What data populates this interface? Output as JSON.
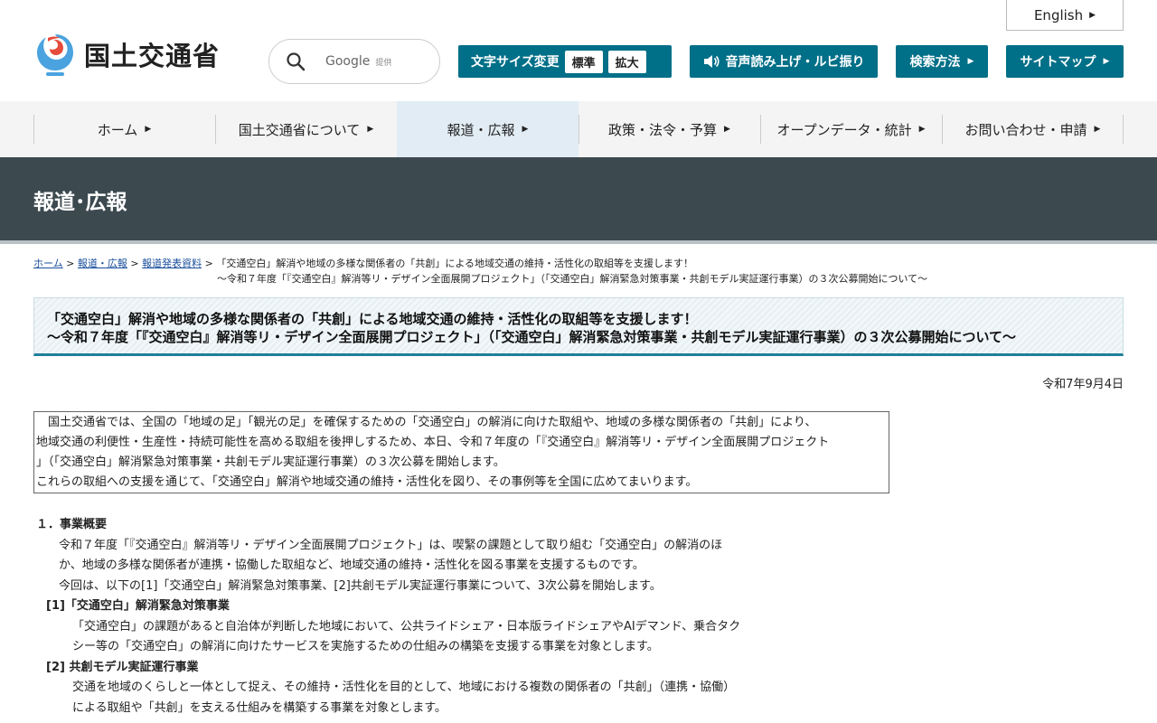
{
  "header": {
    "logo_text": "国土交通省",
    "english_label": "English",
    "search": {
      "google_label": "Google",
      "provided_label": "提供"
    },
    "font_size": {
      "label": "文字サイズ変更",
      "standard": "標準",
      "large": "拡大"
    },
    "voice_label": "音声読み上げ・ルビ振り",
    "howto_label": "検索方法",
    "sitemap_label": "サイトマップ"
  },
  "nav": {
    "items": [
      {
        "label": "ホーム"
      },
      {
        "label": "国土交通省について"
      },
      {
        "label": "報道・広報"
      },
      {
        "label": "政策・法令・予算"
      },
      {
        "label": "オープンデータ・統計"
      },
      {
        "label": "お問い合わせ・申請"
      }
    ]
  },
  "banner": {
    "title": "報道･広報"
  },
  "breadcrumb": {
    "home": "ホーム",
    "press": "報道・広報",
    "releases": "報道発表資料",
    "sep": ">",
    "current_line1": "「交通空白」解消や地域の多様な関係者の「共創」による地域交通の維持・活性化の取組等を支援します！",
    "current_line2": "～令和７年度「『交通空白』解消等リ・デザイン全面展開プロジェクト」（「交通空白」解消緊急対策事業・共創モデル実証運行事業）の３次公募開始について～"
  },
  "title": {
    "line1": "「交通空白」解消や地域の多様な関係者の「共創」による地域交通の維持・活性化の取組等を支援します！",
    "line2": "～令和７年度「『交通空白』解消等リ・デザイン全面展開プロジェクト」（「交通空白」解消緊急対策事業・共創モデル実証運行事業）の３次公募開始について～"
  },
  "date": "令和7年9月4日",
  "summary": {
    "line1": "国土交通省では、全国の「地域の足」「観光の足」を確保するための「交通空白」の解消に向けた取組や、地域の多様な関係者の「共創」により、",
    "line2": "地域交通の利便性・生産性・持続可能性を高める取組を後押しするため、本日、令和７年度の「『交通空白』解消等リ・デザイン全面展開プロジェクト",
    "line3": "」（「交通空白」解消緊急対策事業・共創モデル実証運行事業）の３次公募を開始します。",
    "line4": "これらの取組への支援を通じて、「交通空白」解消や地域交通の維持・活性化を図り、その事例等を全国に広めてまいります。"
  },
  "body": {
    "heading": "１．事業概要",
    "p1_line1": "令和７年度「『交通空白』解消等リ・デザイン全面展開プロジェクト」は、喫緊の課題として取り組む「交通空白」の解消のほ",
    "p1_line2": "か、地域の多様な関係者が連携・協働した取組など、地域交通の維持・活性化を図る事業を支援するものです。",
    "p1_line3": "今回は、以下の[1]「交通空白」解消緊急対策事業、[2]共創モデル実証運行事業について、3次公募を開始します。",
    "sub1": "[1]「交通空白」解消緊急対策事業",
    "sub1_line1": "「交通空白」の課題があると自治体が判断した地域において、公共ライドシェア・日本版ライドシェアやAIデマンド、乗合タク",
    "sub1_line2": "シー等の「交通空白」の解消に向けたサービスを実施するための仕組みの構築を支援する事業を対象とします。",
    "sub2": "[2]  共創モデル実証運行事業",
    "sub2_line1": "交通を地域のくらしと一体として捉え、その維持・活性化を目的として、地域における複数の関係者の「共創」（連携・協働）",
    "sub2_line2": "による取組や「共創」を支える仕組みを構築する事業を対象とします。"
  }
}
